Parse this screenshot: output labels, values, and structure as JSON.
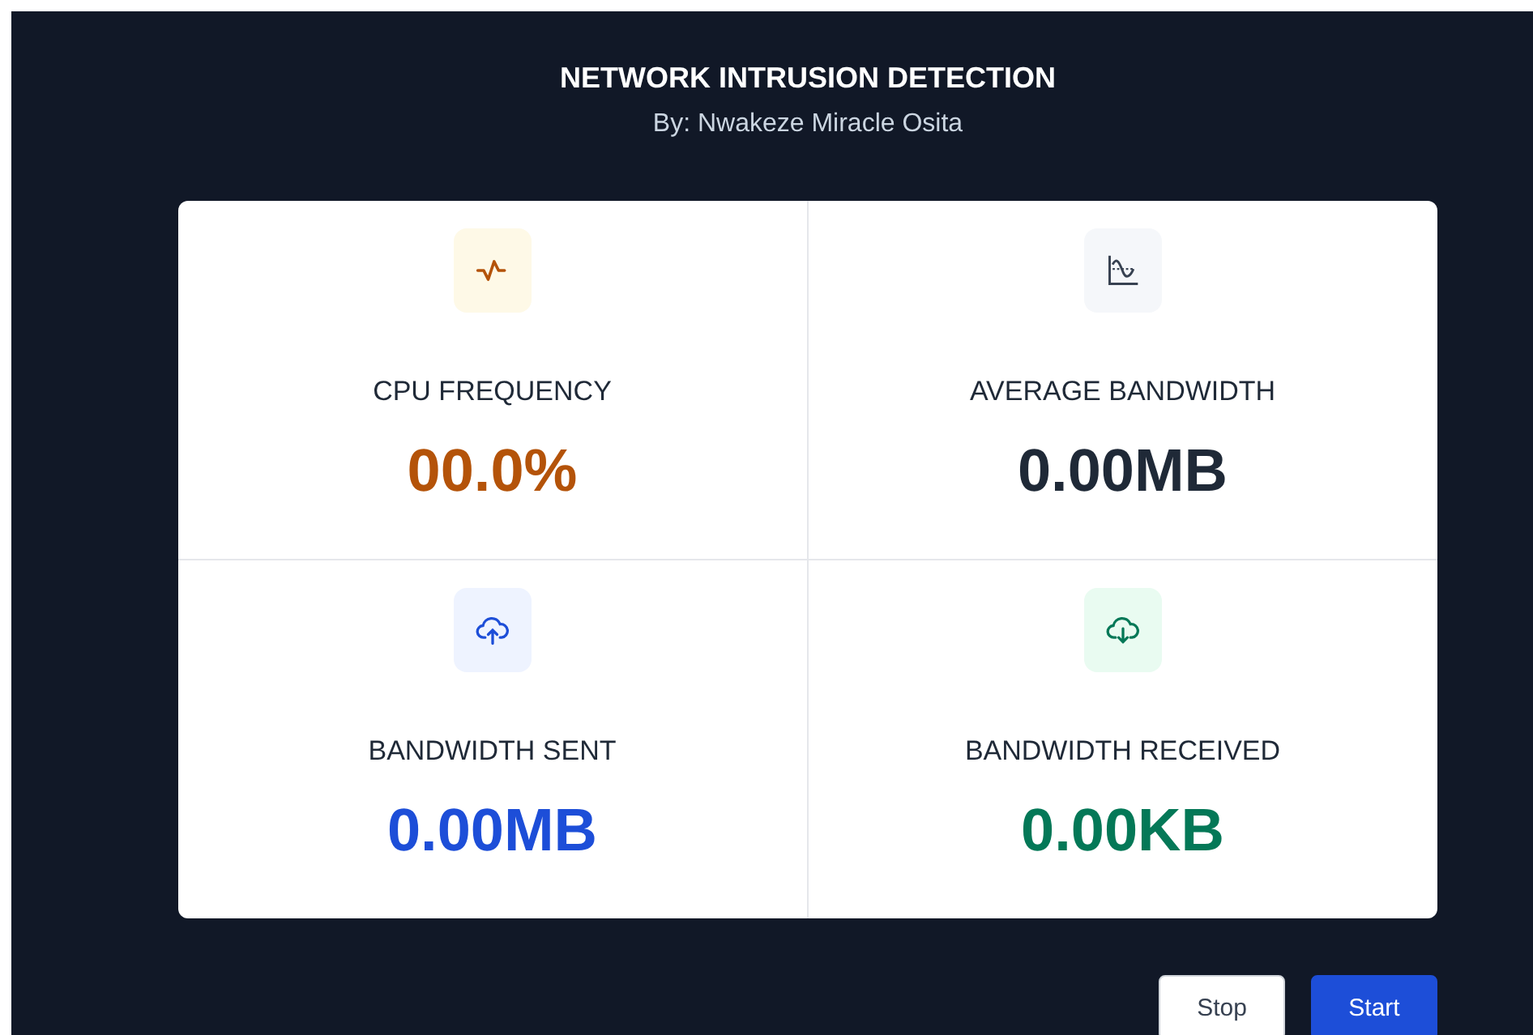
{
  "header": {
    "title": "NETWORK INTRUSION DETECTION",
    "subtitle": "By: Nwakeze Miracle Osita"
  },
  "metrics": [
    {
      "kind": "pulse",
      "label": "CPU FREQUENCY",
      "value": "00.0%",
      "color": "#b45309"
    },
    {
      "kind": "chart",
      "label": "AVERAGE BANDWIDTH",
      "value": "0.00MB",
      "color": "#1f2937"
    },
    {
      "kind": "upload",
      "label": "BANDWIDTH SENT",
      "value": "0.00MB",
      "color": "#1d4ed8"
    },
    {
      "kind": "download",
      "label": "BANDWIDTH RECEIVED",
      "value": "0.00KB",
      "color": "#047857"
    }
  ],
  "buttons": [
    {
      "label": "Stop",
      "kind": "secondary"
    },
    {
      "label": "Start",
      "kind": "primary"
    }
  ]
}
